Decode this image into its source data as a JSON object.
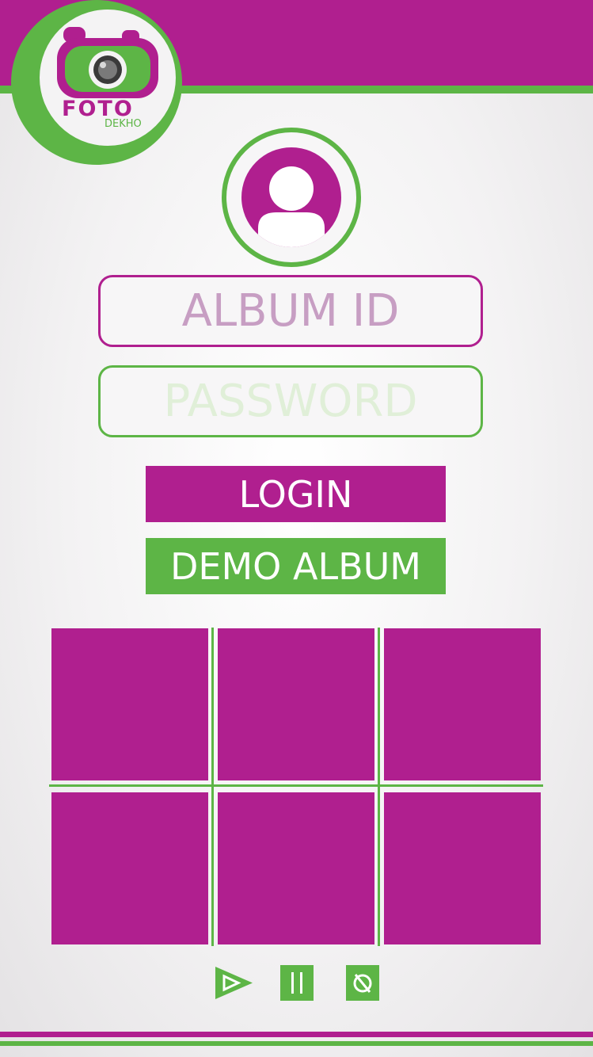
{
  "brand": {
    "name": "FOTO",
    "tagline": "DEKHO"
  },
  "form": {
    "album_id_placeholder": "ALBUM ID",
    "password_placeholder": "PASSWORD"
  },
  "buttons": {
    "login": "LOGIN",
    "demo": "DEMO ALBUM"
  },
  "gallery": {
    "rows": 2,
    "columns": 3
  },
  "controls": [
    "play-icon",
    "pause-icon",
    "stop-icon"
  ],
  "colors": {
    "primary": "#b01f8f",
    "secondary": "#5db546"
  }
}
